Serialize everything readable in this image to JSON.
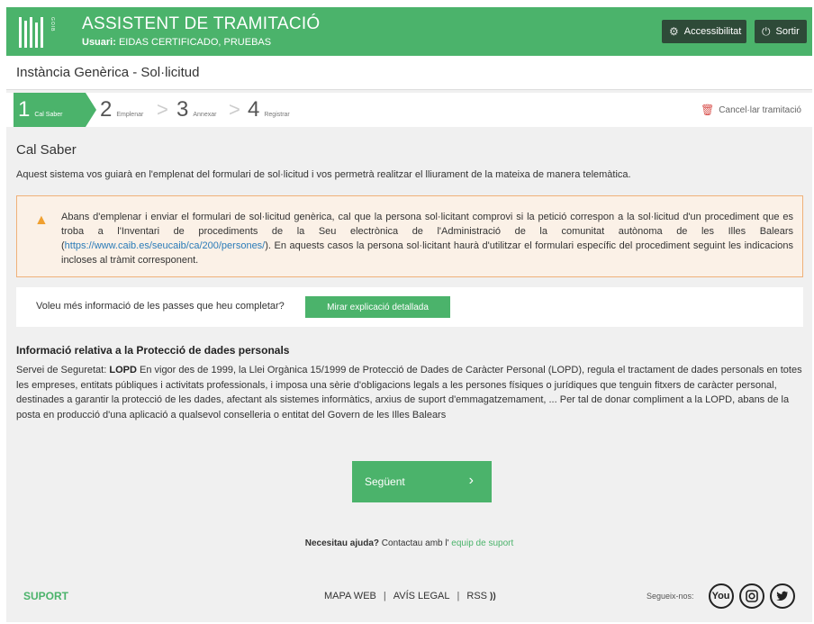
{
  "header": {
    "title": "ASSISTENT DE TRAMITACIÓ",
    "user_label": "Usuari:",
    "user_name": "EIDAS CERTIFICADO, PRUEBAS",
    "logo_vertical_text": "GOIB",
    "accessibility_label": "Accessibilitat",
    "logout_label": "Sortir"
  },
  "page_title": "Instància Genèrica - Sol·licitud",
  "steps": [
    {
      "num": "1",
      "label": "Cal Saber"
    },
    {
      "num": "2",
      "label": "Emplenar"
    },
    {
      "num": "3",
      "label": "Annexar"
    },
    {
      "num": "4",
      "label": "Registrar"
    }
  ],
  "cancel_label": "Cancel·lar tramitació",
  "section_title": "Cal Saber",
  "intro": "Aquest sistema vos guiarà en l'emplenat del formulari de sol·licitud i vos permetrà realitzar el lliurament de la mateixa de manera telemàtica.",
  "warning": {
    "text_before": "Abans d'emplenar i enviar el formulari de sol·licitud genèrica, cal que la persona sol·licitant comprovi si la petició correspon a la sol·licitud d'un procediment que es troba a l'Inventari de procediments de la Seu electrònica de l'Administració de la comunitat autònoma de les Illes Balears (",
    "link": "https://www.caib.es/seucaib/ca/200/persones/",
    "text_after": "). En aquests casos la persona sol·licitant haurà d'utilitzar el formulari específic del procediment seguint les indicacions incloses al tràmit corresponent."
  },
  "info": {
    "question": "Voleu més informació de les passes que heu completar?",
    "button": "Mirar explicació detallada"
  },
  "lopd": {
    "title": "Informació relativa a la Protecció de dades personals",
    "prefix": "Servei de Seguretat:",
    "bold": "LOPD",
    "text": "En vigor des de 1999, la Llei Orgànica 15/1999 de Protecció de Dades de Caràcter Personal (LOPD), regula el tractament de dades personals en totes les empreses, entitats públiques i activitats professionals, i imposa una sèrie d'obligacions legals a les persones físiques o jurídiques que tenguin fitxers de caràcter personal, destinades a garantir la protecció de les dades, afectant als sistemes informàtics, arxius de suport d'emmagatzemament, ... Per tal de donar compliment a la LOPD, abans de la posta en producció d'una aplicació a qualsevol conselleria o entitat del Govern de les Illes Balears"
  },
  "next_button": "Següent",
  "help": {
    "bold": "Necesitau ajuda?",
    "text": "Contactau amb l'",
    "link": "equip de suport"
  },
  "footer": {
    "support": "SUPORT",
    "map": "MAPA WEB",
    "legal": "AVÍS LEGAL",
    "rss": "RSS",
    "follow": "Segueix-nos:",
    "youtube_text": "You"
  },
  "colors": {
    "brand_green": "#4bb36b",
    "header_button": "#2e4a38",
    "warning_border": "#efb17a",
    "warning_bg": "#fbf1e7",
    "link_blue": "#2a7bb8"
  }
}
